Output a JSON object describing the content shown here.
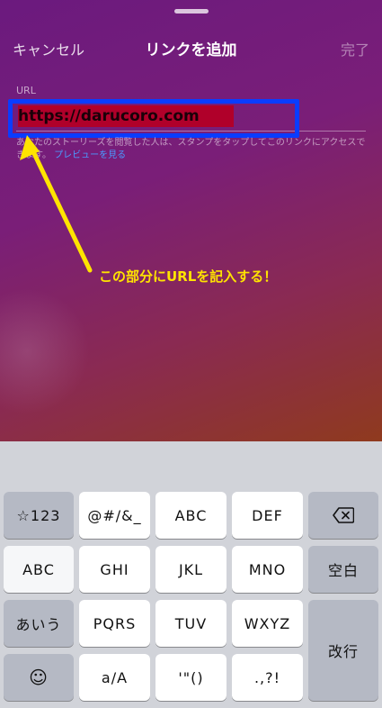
{
  "nav": {
    "cancel": "キャンセル",
    "title": "リンクを追加",
    "done": "完了"
  },
  "url": {
    "label": "URL",
    "value": "https://darucoro.com"
  },
  "help": {
    "text": "あなたのストーリーズを閲覧した人は、スタンプをタップしてこのリンクにアクセスできます。",
    "link": "プレビューを見る"
  },
  "annotation": {
    "text": "この部分にURLを記入する！",
    "color": "#ffe400",
    "box_color": "#0a3cff"
  },
  "keyboard": {
    "row1": [
      "☆123",
      "@#/&_",
      "ABC",
      "DEF",
      "⌫"
    ],
    "row2": [
      "ABC",
      "GHI",
      "JKL",
      "MNO",
      "空白"
    ],
    "row3": [
      "あいう",
      "PQRS",
      "TUV",
      "WXYZ",
      "改行"
    ],
    "row4": [
      "☺",
      "a/A",
      "'\"()",
      ".,?!"
    ]
  }
}
